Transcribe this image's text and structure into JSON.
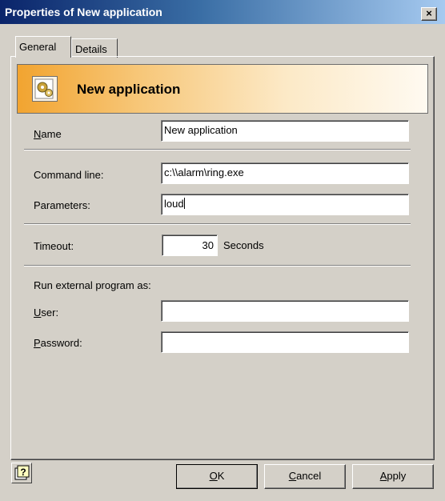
{
  "window": {
    "title": "Properties of New application",
    "close_glyph": "×"
  },
  "tabs": [
    {
      "label": "General",
      "active": true
    },
    {
      "label": "Details",
      "active": false
    }
  ],
  "banner": {
    "title": "New application",
    "icon": "application-gears-icon"
  },
  "form": {
    "name": {
      "label_first": "N",
      "label_rest": "ame",
      "value": "New application"
    },
    "command_line": {
      "label": "Command line:",
      "value": "c:\\\\alarm\\ring.exe"
    },
    "parameters": {
      "label": "Parameters:",
      "value": "loud"
    },
    "timeout": {
      "label": "Timeout:",
      "value": "30",
      "unit": "Seconds"
    },
    "run_as": {
      "label": "Run external program as:"
    },
    "user": {
      "label_first": "U",
      "label_rest": "ser:",
      "value": ""
    },
    "password": {
      "label_first": "P",
      "label_rest": "assword:",
      "value": ""
    }
  },
  "buttons": {
    "ok": {
      "first": "O",
      "rest": "K"
    },
    "cancel": {
      "first": "C",
      "rest": "ancel"
    },
    "apply": {
      "first": "A",
      "rest": "pply"
    },
    "help_icon": "help-question-icon"
  },
  "colors": {
    "titlebar_start": "#0a246a",
    "banner_accent": "#f2a430",
    "face": "#d4d0c8"
  }
}
